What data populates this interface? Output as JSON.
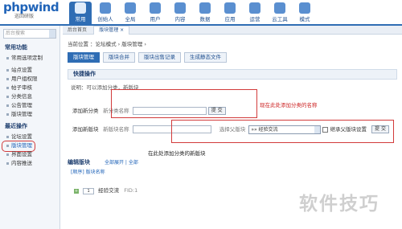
{
  "app": {
    "logo": "phpwind",
    "logo_sub": "巡回研版"
  },
  "nav": [
    {
      "label": "常用"
    },
    {
      "label": "创始人"
    },
    {
      "label": "全局"
    },
    {
      "label": "用户"
    },
    {
      "label": "内容"
    },
    {
      "label": "数据"
    },
    {
      "label": "应用"
    },
    {
      "label": "运营"
    },
    {
      "label": "云工具"
    },
    {
      "label": "模式"
    }
  ],
  "sidebar": {
    "search_placeholder": "后台搜索",
    "sections": [
      {
        "title": "常用功能",
        "items": [
          {
            "label": "常用选项定制"
          }
        ]
      },
      {
        "title": "",
        "items": [
          {
            "label": "站点设置"
          },
          {
            "label": "用户组权限"
          },
          {
            "label": "帖子审核"
          },
          {
            "label": "分类信息"
          },
          {
            "label": "公告管理"
          },
          {
            "label": "版块管理"
          }
        ]
      },
      {
        "title": "最近操作",
        "items": [
          {
            "label": "论坛设置"
          },
          {
            "label": "版块管理"
          },
          {
            "label": "界面设置"
          },
          {
            "label": "内容推送"
          }
        ]
      }
    ]
  },
  "tabs": [
    {
      "label": "后台首页"
    },
    {
      "label": "版块管理 ×"
    }
  ],
  "breadcrumb": "当前位置 ：论坛模式 › 版块管理 ›",
  "subnav": [
    {
      "label": "版块管理"
    },
    {
      "label": "版块合并"
    },
    {
      "label": "版块出售记录"
    },
    {
      "label": "生成静态文件"
    }
  ],
  "quick": {
    "title": "快捷操作",
    "note": "说明：可以添加分类，新版块",
    "add_category": {
      "label": "添加新分类",
      "field": "新分类名称",
      "button": "提 交"
    },
    "add_forum": {
      "label": "添加新版块",
      "field": "新版块名称",
      "parent_label": "选择父版块",
      "parent_value": "»» 经验交流",
      "inherit": "继承父版块设置",
      "button": "提 交"
    }
  },
  "annotations": {
    "category": "现在此处添加分类的名称",
    "forum": "在此处添加分类的新版块"
  },
  "edit": {
    "title": "编辑版块",
    "links": "全部展开 | 全部",
    "order_label": "[顺序] 版块名称",
    "leaf": {
      "order": "1",
      "name": "经验交流",
      "fid": "FID:1"
    }
  },
  "watermark": "软件技巧"
}
